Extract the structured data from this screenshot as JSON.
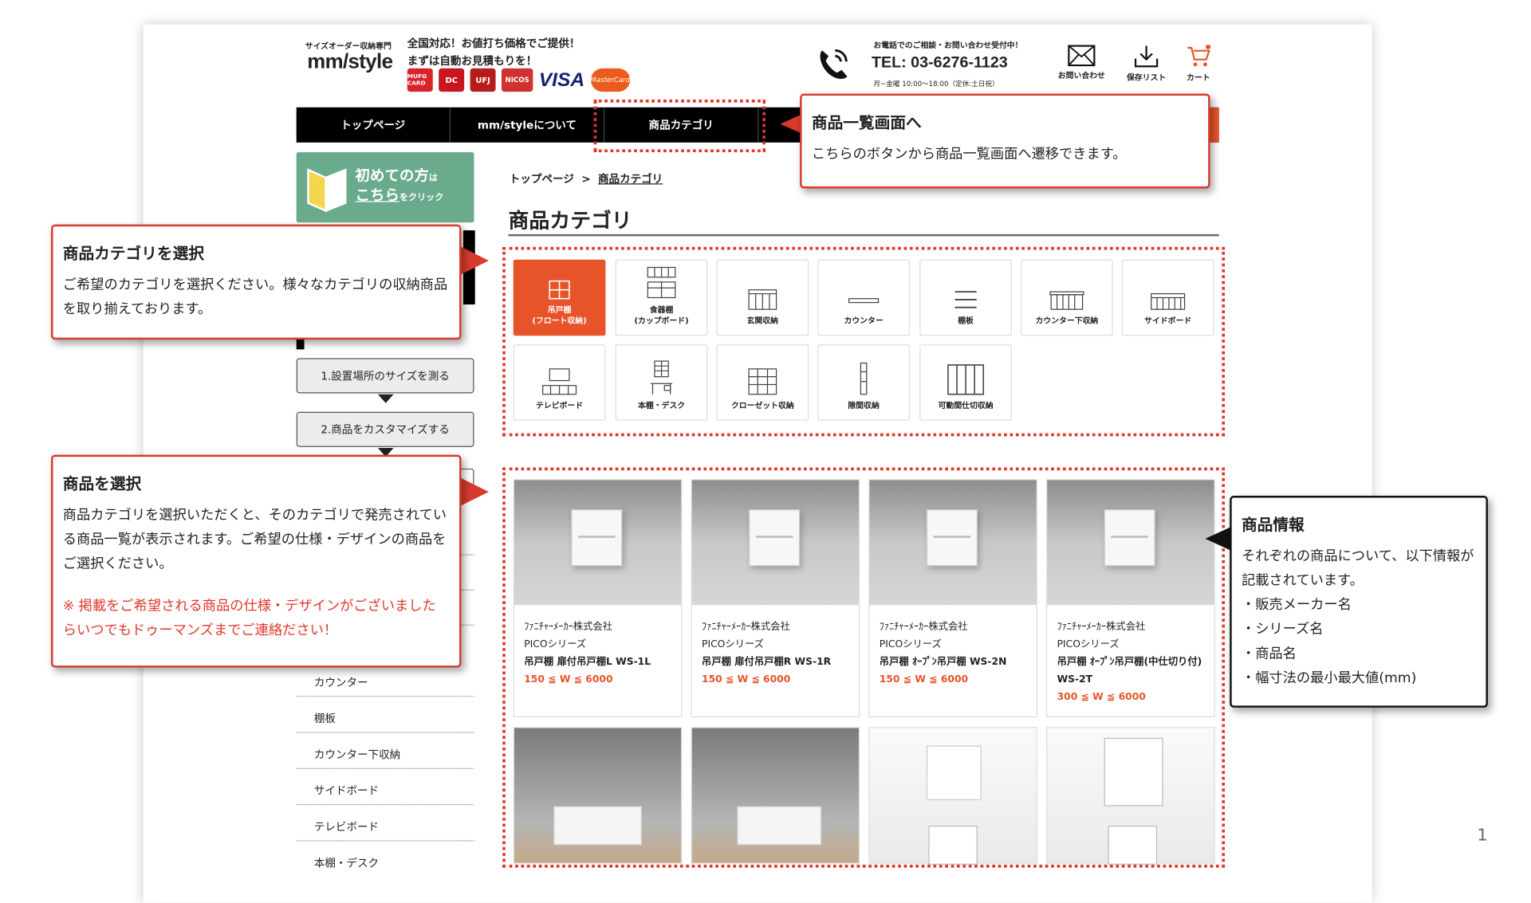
{
  "header": {
    "logo_sub": "サイズオーダー収納専門",
    "logo": "mm/style",
    "tagline1": "全国対応！お値打ち価格でご提供！",
    "tagline2": "まずは自動お見積もりを！",
    "cards": [
      "MUFG CARD",
      "DC",
      "UFJ",
      "NICOS",
      "VISA",
      "MasterCard"
    ],
    "tel_sub": "お電話でのご相談・お問い合わせ受付中！",
    "tel": "TEL: 03-6276-1123",
    "tel_hours": "月~金曜 10:00〜18:00（定休:土日祝）",
    "icons": [
      {
        "label": "お問い合わせ",
        "icon": "mail-icon"
      },
      {
        "label": "保存リスト",
        "icon": "download-icon"
      },
      {
        "label": "カート",
        "icon": "cart-icon"
      }
    ]
  },
  "nav": {
    "items": [
      "トップページ",
      "mm/styleについて",
      "商品カテゴリ"
    ]
  },
  "sidebar": {
    "first_line1": "初めての方",
    "first_ha": "は",
    "first_line2": "こちら",
    "first_click": "をクリック",
    "steps": [
      "1.設置場所のサイズを測る",
      "2.商品をカスタマイズする"
    ],
    "links": [
      "カウンター",
      "棚板",
      "カウンター下収納",
      "サイドボード",
      "テレビボード",
      "本棚・デスク"
    ]
  },
  "main": {
    "crumb_home": "トップページ",
    "crumb_sep": ">",
    "crumb_current": "商品カテゴリ",
    "title": "商品カテゴリ",
    "categories": [
      {
        "l1": "吊戸棚",
        "l2": "(フロート収納)"
      },
      {
        "l1": "食器棚",
        "l2": "(カップボード)"
      },
      {
        "l1": "玄関収納",
        "l2": ""
      },
      {
        "l1": "カウンター",
        "l2": ""
      },
      {
        "l1": "棚板",
        "l2": ""
      },
      {
        "l1": "カウンター下収納",
        "l2": ""
      },
      {
        "l1": "サイドボード",
        "l2": ""
      },
      {
        "l1": "テレビボード",
        "l2": ""
      },
      {
        "l1": "本棚・デスク",
        "l2": ""
      },
      {
        "l1": "クローゼット収納",
        "l2": ""
      },
      {
        "l1": "隙間収納",
        "l2": ""
      },
      {
        "l1": "可動間仕切収納",
        "l2": ""
      }
    ],
    "products": [
      {
        "maker": "ﾌｧﾆﾁｬｰﾒｰｶｰ株式会社",
        "series": "PICOシリーズ",
        "name": "吊戸棚 扉付吊戸棚L WS-1L",
        "size": "150 ≦ W ≦ 6000"
      },
      {
        "maker": "ﾌｧﾆﾁｬｰﾒｰｶｰ株式会社",
        "series": "PICOシリーズ",
        "name": "吊戸棚 扉付吊戸棚R WS-1R",
        "size": "150 ≦ W ≦ 6000"
      },
      {
        "maker": "ﾌｧﾆﾁｬｰﾒｰｶｰ株式会社",
        "series": "PICOシリーズ",
        "name": "吊戸棚 ｵｰﾌﾟﾝ吊戸棚 WS-2N",
        "size": "150 ≦ W ≦ 6000"
      },
      {
        "maker": "ﾌｧﾆﾁｬｰﾒｰｶｰ株式会社",
        "series": "PICOシリーズ",
        "name": "吊戸棚 ｵｰﾌﾟﾝ吊戸棚(中仕切り付) WS-2T",
        "size": "300 ≦ W ≦ 6000"
      }
    ]
  },
  "callouts": {
    "list": {
      "title": "商品一覧画面へ",
      "body": "こちらのボタンから商品一覧画面へ遷移できます。"
    },
    "category": {
      "title": "商品カテゴリを選択",
      "body": "ご希望のカテゴリを選択ください。様々なカテゴリの収納商品を取り揃えております。"
    },
    "product": {
      "title": "商品を選択",
      "body": "商品カテゴリを選択いただくと、そのカテゴリで発売されている商品一覧が表示されます。ご希望の仕様・デザインの商品をご選択ください。",
      "warn": "※ 掲載をご希望される商品の仕様・デザインがございましたらいつでもドゥーマンズまでご連絡ださい！"
    },
    "info": {
      "title": "商品情報",
      "body": "それぞれの商品について、以下情報が記載されています。",
      "items": [
        "・販売メーカー名",
        "・シリーズ名",
        "・商品名",
        "・幅寸法の最小最大値(mm)"
      ]
    }
  },
  "page_number": "1",
  "colors": {
    "accent": "#e8542a",
    "callout_red": "#d83a2e",
    "green": "#6aab8d"
  }
}
